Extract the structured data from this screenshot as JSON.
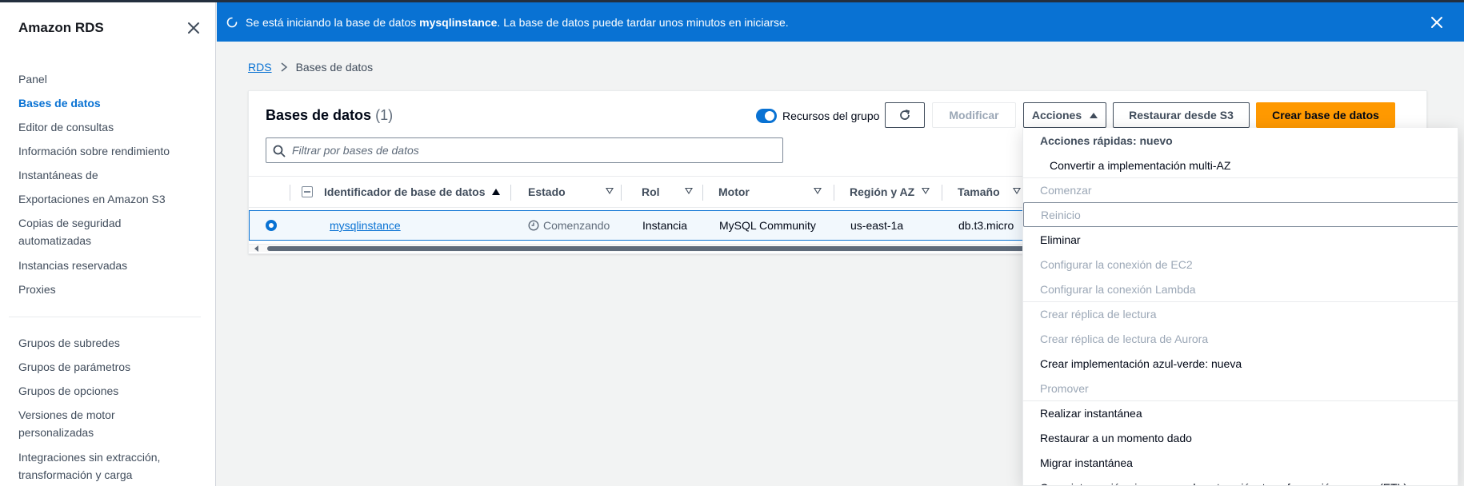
{
  "sidebar": {
    "title": "Amazon RDS",
    "items": [
      {
        "label": "Panel"
      },
      {
        "label": "Bases de datos"
      },
      {
        "label": "Editor de consultas"
      },
      {
        "label": "Información sobre rendimiento"
      },
      {
        "label": "Instantáneas de"
      },
      {
        "label": "Exportaciones en Amazon S3"
      },
      {
        "label": "Copias de seguridad automatizadas"
      },
      {
        "label": "Instancias reservadas"
      },
      {
        "label": "Proxies"
      }
    ],
    "items2": [
      {
        "label": "Grupos de subredes"
      },
      {
        "label": "Grupos de parámetros"
      },
      {
        "label": "Grupos de opciones"
      },
      {
        "label": "Versiones de motor personalizadas"
      },
      {
        "label": "Integraciones sin extracción, transformación y carga"
      }
    ]
  },
  "flash": {
    "prefix": "Se está iniciando la base de datos ",
    "db_name": "mysqlinstance",
    "suffix": ". La base de datos puede tardar unos minutos en iniciarse."
  },
  "breadcrumb": {
    "root": "RDS",
    "current": "Bases de datos"
  },
  "container": {
    "title": "Bases de datos",
    "count": "(1)",
    "toggle_label": "Recursos del grupo",
    "modify_label": "Modificar",
    "actions_label": "Acciones",
    "restore_label": "Restaurar desde S3",
    "create_label": "Crear base de datos",
    "search_placeholder": "Filtrar por bases de datos"
  },
  "table": {
    "headers": [
      "Identificador de base de datos",
      "Estado",
      "Rol",
      "Motor",
      "Región y AZ",
      "Tamaño"
    ],
    "row": {
      "id": "mysqlinstance",
      "status": "Comenzando",
      "role": "Instancia",
      "engine": "MySQL Community",
      "region": "us-east-1a",
      "size": "db.t3.micro"
    }
  },
  "dropdown": {
    "quick_header": "Acciones rápidas: nuevo",
    "items": [
      "Convertir a implementación multi-AZ",
      "Comenzar",
      "Reinicio",
      "Eliminar",
      "Configurar la conexión de EC2",
      "Configurar la conexión Lambda",
      "Crear réplica de lectura",
      "Crear réplica de lectura de Aurora",
      "Crear implementación azul-verde: nueva",
      "Promover",
      "Realizar instantánea",
      "Restaurar a un momento dado",
      "Migrar instantánea",
      "Crear integración sin proceso de extracción, transformación y carga (ETL)"
    ]
  },
  "colors": {
    "accent": "#0972d3",
    "primary_button": "#ff9900",
    "disabled_text": "#9ba7b6"
  }
}
